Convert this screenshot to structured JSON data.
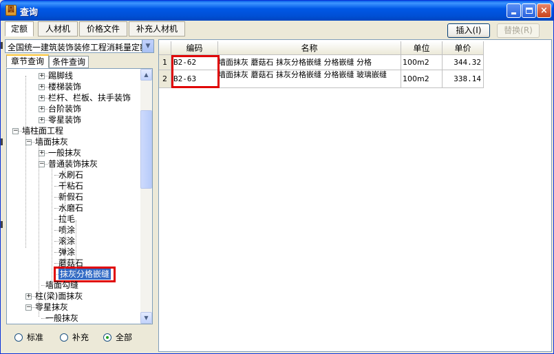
{
  "window": {
    "title": "查询",
    "app_icon": "app-icon"
  },
  "titlebar_buttons": {
    "minimize": "minimize-icon",
    "maximize": "maximize-icon",
    "close": "×"
  },
  "toolbar": {
    "tabs": [
      {
        "label": "定额",
        "active": true
      },
      {
        "label": "人材机",
        "active": false
      },
      {
        "label": "价格文件",
        "active": false
      },
      {
        "label": "补充人材机",
        "active": false
      }
    ],
    "insert_label": "插入(I)",
    "replace_label": "替换(R)"
  },
  "left": {
    "dropdown_value": "全国统一建筑装饰装修工程消耗量定额",
    "dropdown_arrow": "▼",
    "subtabs": [
      {
        "label": "章节查询",
        "active": true
      },
      {
        "label": "条件查询",
        "active": false
      }
    ],
    "tree": [
      {
        "label": "踢脚线",
        "expander": "+"
      },
      {
        "label": "楼梯装饰",
        "expander": "+"
      },
      {
        "label": "栏杆、栏板、扶手装饰",
        "expander": "+"
      },
      {
        "label": "台阶装饰",
        "expander": "+"
      },
      {
        "label": "零星装饰",
        "expander": "+"
      },
      {
        "label": "墙柱面工程",
        "expander": "−"
      },
      {
        "label": "墙面抹灰",
        "expander": "−"
      },
      {
        "label": "一般抹灰",
        "expander": "+"
      },
      {
        "label": "普通装饰抹灰",
        "expander": "−"
      },
      {
        "label": "水刷石",
        "expander": ""
      },
      {
        "label": "干粘石",
        "expander": ""
      },
      {
        "label": "新假石",
        "expander": ""
      },
      {
        "label": "水磨石",
        "expander": ""
      },
      {
        "label": "拉毛",
        "expander": ""
      },
      {
        "label": "喷涂",
        "expander": ""
      },
      {
        "label": "滚涂",
        "expander": ""
      },
      {
        "label": "弹涂",
        "expander": ""
      },
      {
        "label": "蘑菇石",
        "expander": ""
      },
      {
        "label": "抹灰分格嵌缝",
        "expander": "",
        "selected": true
      },
      {
        "label": "墙面勾缝",
        "expander": ""
      },
      {
        "label": "柱(梁)面抹灰",
        "expander": "+"
      },
      {
        "label": "零星抹灰",
        "expander": "−"
      },
      {
        "label": "一般抹灰",
        "expander": ""
      }
    ],
    "scroll_up": "▲",
    "scroll_down": "▼",
    "radios": [
      {
        "label": "标准",
        "checked": false
      },
      {
        "label": "补充",
        "checked": false
      },
      {
        "label": "全部",
        "checked": true
      }
    ]
  },
  "grid": {
    "headers": [
      "",
      "编码",
      "名称",
      "单位",
      "单价"
    ],
    "rows": [
      {
        "num": "1",
        "code": "B2-62",
        "name": "墙面抹灰 蘑菇石 抹灰分格嵌缝 分格嵌缝 分格",
        "unit": "100m2",
        "price": "344.32"
      },
      {
        "num": "2",
        "code": "B2-63",
        "name": "墙面抹灰 蘑菇石 抹灰分格嵌缝 分格嵌缝 玻璃嵌缝",
        "unit": "100m2",
        "price": "338.14"
      }
    ]
  },
  "colors": {
    "titlebar": "#0054e3",
    "selection": "#316ac5",
    "highlight_box": "#e00000"
  }
}
